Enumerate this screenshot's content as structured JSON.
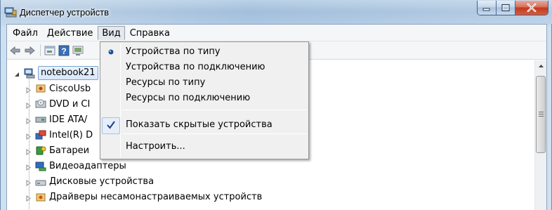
{
  "window": {
    "title": "Диспетчер устройств",
    "accent": "#c2391c"
  },
  "menubar": {
    "items": [
      "Файл",
      "Действие",
      "Вид",
      "Справка"
    ],
    "open_index": 2
  },
  "toolbar": {
    "buttons": [
      "back-icon",
      "forward-icon",
      "properties-icon",
      "help-icon",
      "scan-icon"
    ]
  },
  "tree": {
    "root": "notebook21",
    "items": [
      {
        "label": "CiscoUsb",
        "icon": "usb-device-icon"
      },
      {
        "label": "DVD и CI",
        "icon": "dvd-icon"
      },
      {
        "label": "IDE ATA/",
        "icon": "ide-icon"
      },
      {
        "label": "Intel(R) D",
        "icon": "intel-icon"
      },
      {
        "label": "Батареи",
        "icon": "battery-icon"
      },
      {
        "label": "Видеоадаптеры",
        "icon": "display-adapter-icon"
      },
      {
        "label": "Дисковые устройства",
        "icon": "disk-icon"
      },
      {
        "label": "Драйверы несамонастраиваемых устройств",
        "icon": "driver-icon"
      }
    ]
  },
  "view_menu": {
    "items": [
      {
        "label": "Устройства по типу",
        "mark": "radio"
      },
      {
        "label": "Устройства по подключению",
        "mark": "none"
      },
      {
        "label": "Ресурсы по типу",
        "mark": "none"
      },
      {
        "label": "Ресурсы по подключению",
        "mark": "none"
      },
      {
        "label": "Показать скрытые устройства",
        "mark": "check"
      },
      {
        "label": "Настроить...",
        "mark": "none"
      }
    ]
  }
}
